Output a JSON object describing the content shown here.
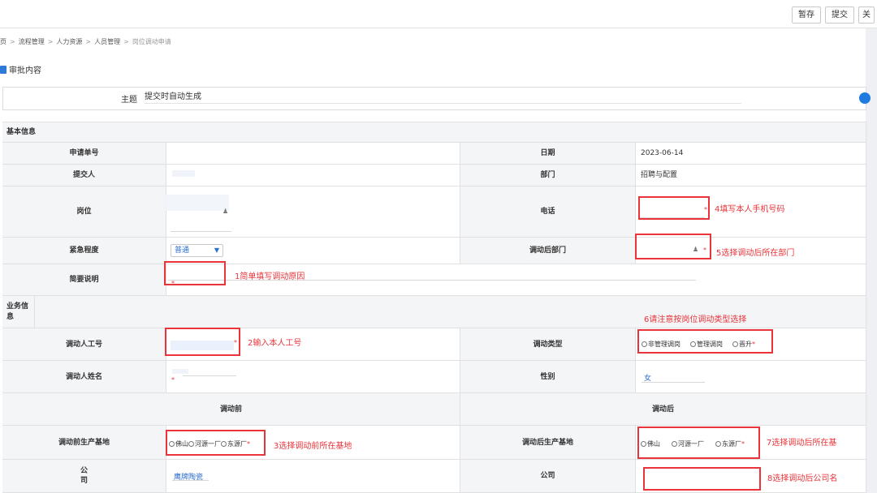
{
  "toolbar": {
    "save_label": "暂存",
    "submit_label": "提交",
    "close_label": "关"
  },
  "breadcrumb": {
    "items": [
      "页",
      "流程管理",
      "人力资源",
      "人员管理"
    ],
    "current": "岗位调动申请"
  },
  "section": {
    "title": "审批内容"
  },
  "subject": {
    "label": "主题",
    "value": "提交时自动生成"
  },
  "form": {
    "basic_title": "基本信息",
    "business_title": "业务信息",
    "labels": {
      "apply_no": "申请单号",
      "date": "日期",
      "submitter": "提交人",
      "department": "部门",
      "position": "岗位",
      "phone": "电话",
      "urgency": "紧急程度",
      "new_department": "调动后部门",
      "brief": "简要说明",
      "emp_no": "调动人工号",
      "transfer_type": "调动类型",
      "emp_name": "调动人姓名",
      "gender": "性别",
      "before": "调动前",
      "after": "调动后",
      "base_before": "调动前生产基地",
      "base_after": "调动后生产基地",
      "company": "公司",
      "company_after": "公司"
    },
    "values": {
      "date": "2023-06-14",
      "department": "招聘与配置",
      "urgency": "普通",
      "gender": "女",
      "company_before": "鹰牌陶瓷"
    },
    "transfer_type_options": [
      "非管理调岗",
      "管理调岗",
      "晋升"
    ],
    "base_options_before": [
      "佛山",
      "河源一厂",
      "东源厂"
    ],
    "base_options_after": [
      "佛山",
      "河源一厂",
      "东源厂"
    ]
  },
  "annotations": {
    "a1": "1简单填写调动原因",
    "a2": "2输入本人工号",
    "a3": "3选择调动前所在基地",
    "a4": "4填写本人手机号码",
    "a5": "5选择调动后所在部门",
    "a6": "6请注意按岗位调动类型选择",
    "a7": "7选择调动后所在基",
    "a8": "8选择调动后公司名"
  },
  "colors": {
    "accent": "#1f7be0",
    "annotation_red": "#e8343a",
    "label_bg": "#f4f5f7"
  }
}
